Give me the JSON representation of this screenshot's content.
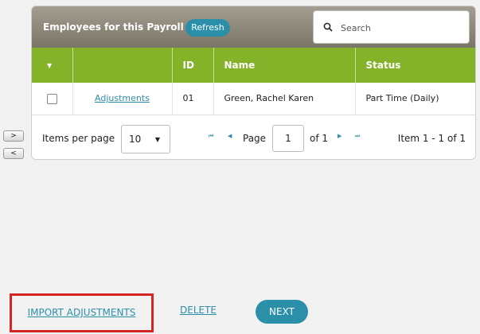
{
  "side_buttons": {
    "next": ">",
    "prev": "<"
  },
  "grid": {
    "title": "Employees for this Payroll",
    "refresh_label": "Refresh",
    "search_placeholder": "Search",
    "columns": {
      "select": "▼",
      "action": "",
      "id": "ID",
      "name": "Name",
      "status": "Status"
    },
    "rows": [
      {
        "action": "Adjustments",
        "id": "01",
        "name": "Green, Rachel Karen",
        "status": "Part Time (Daily)"
      }
    ]
  },
  "pager": {
    "items_per_page_label": "Items per page",
    "items_per_page_value": "10",
    "page_label": "Page",
    "page_value": "1",
    "of_label": "of 1",
    "item_range": "Item 1 - 1 of 1"
  },
  "actions": {
    "import_label": "IMPORT ADJUSTMENTS",
    "delete_label": "DELETE",
    "next_label": "NEXT"
  },
  "colors": {
    "accent": "#2b8faa",
    "header_green": "#84b229",
    "highlight": "#d42424"
  }
}
